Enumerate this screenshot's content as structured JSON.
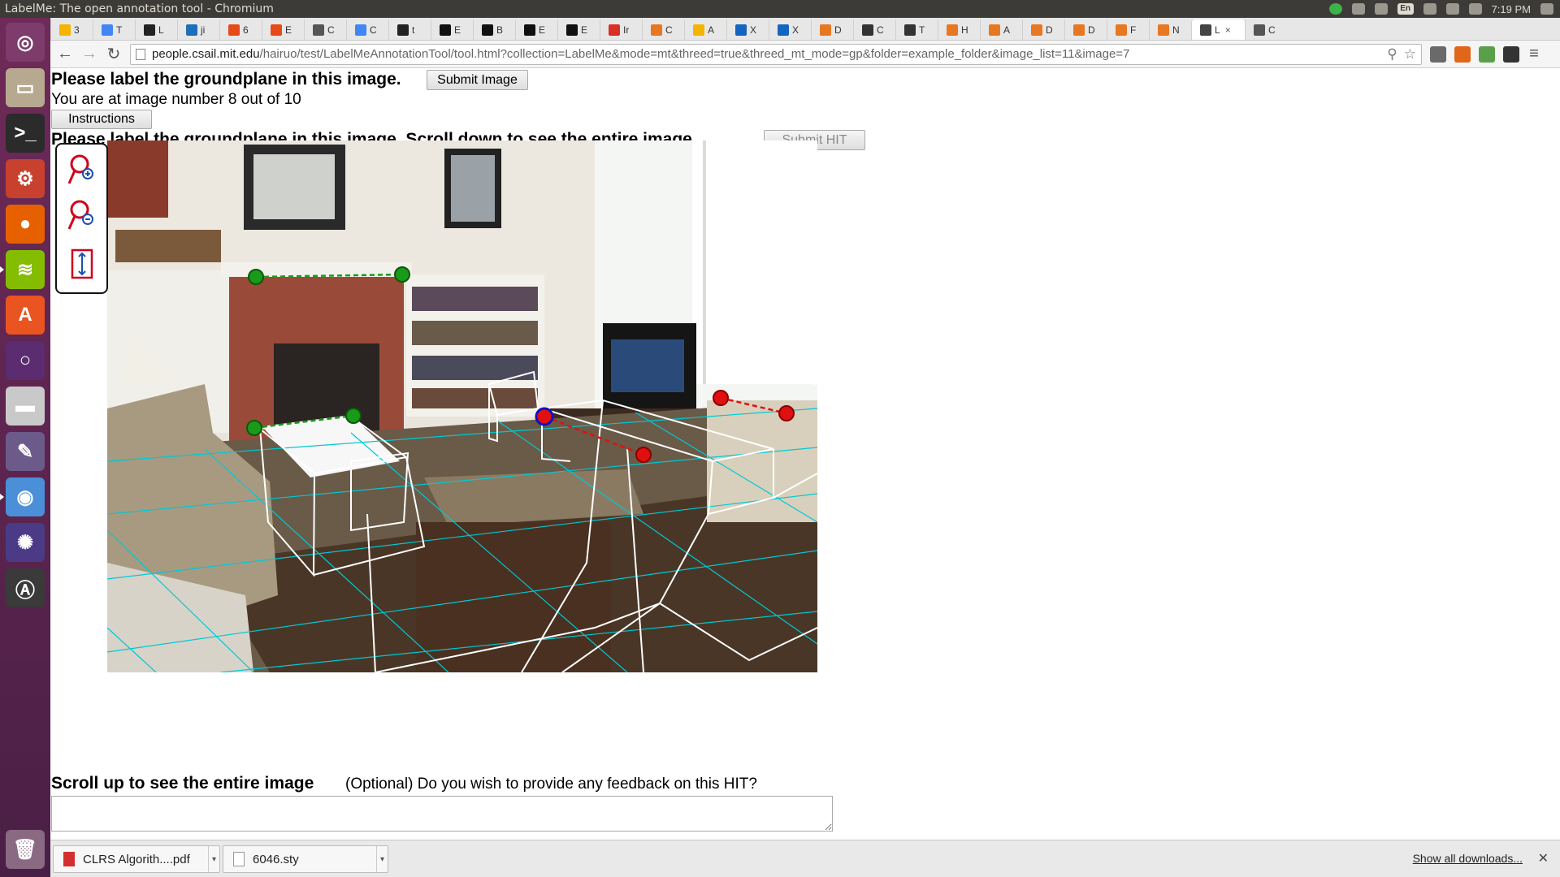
{
  "window": {
    "title": "LabelMe: The open annotation tool - Chromium"
  },
  "tray": {
    "lang": "En",
    "time": "7:19 PM"
  },
  "tabs": [
    {
      "label": "3",
      "color": "#f4b400"
    },
    {
      "label": "T",
      "color": "#4285f4"
    },
    {
      "label": "L",
      "color": "#222222"
    },
    {
      "label": "ji",
      "color": "#1e6fb8"
    },
    {
      "label": "6",
      "color": "#e64a19"
    },
    {
      "label": "E",
      "color": "#e64a19"
    },
    {
      "label": "C",
      "color": "#555555"
    },
    {
      "label": "C",
      "color": "#4285f4"
    },
    {
      "label": "t",
      "color": "#222222"
    },
    {
      "label": "E",
      "color": "#111111"
    },
    {
      "label": "B",
      "color": "#111111"
    },
    {
      "label": "E",
      "color": "#111111"
    },
    {
      "label": "E",
      "color": "#111111"
    },
    {
      "label": "Ir",
      "color": "#d93025"
    },
    {
      "label": "C",
      "color": "#e87722"
    },
    {
      "label": "A",
      "color": "#f4b400"
    },
    {
      "label": "X",
      "color": "#1565c0"
    },
    {
      "label": "X",
      "color": "#1565c0"
    },
    {
      "label": "D",
      "color": "#e87722"
    },
    {
      "label": "C",
      "color": "#333333"
    },
    {
      "label": "T",
      "color": "#333333"
    },
    {
      "label": "H",
      "color": "#e87722"
    },
    {
      "label": "A",
      "color": "#e87722"
    },
    {
      "label": "D",
      "color": "#e87722"
    },
    {
      "label": "D",
      "color": "#e87722"
    },
    {
      "label": "F",
      "color": "#e87722"
    },
    {
      "label": "N",
      "color": "#e87722"
    },
    {
      "label": "L",
      "color": "#444444",
      "active": true
    },
    {
      "label": "C",
      "color": "#555555"
    }
  ],
  "omnibox": {
    "host": "people.csail.mit.edu",
    "path": "/hairuo/test/LabelMeAnnotationTool/tool.html?collection=LabelMe&mode=mt&threed=true&threed_mt_mode=gp&folder=example_folder&image_list=11&image=7"
  },
  "page": {
    "heading": "Please label the groundplane in this image.",
    "submit_image": "Submit Image",
    "progress": "You are at image number 8 out of 10",
    "instructions": "Instructions",
    "heading2": "Please label the groundplane in this image. Scroll down to see the entire image.",
    "submit_hit": "Submit HIT",
    "scroll_up": "Scroll up to see the entire image",
    "feedback_q": "(Optional) Do you wish to provide any feedback on this HIT?",
    "feedback_value": ""
  },
  "toolbox": {
    "tools": [
      "zoom-in-icon",
      "zoom-out-icon",
      "fit-image-icon"
    ]
  },
  "downloads": {
    "items": [
      {
        "name": "CLRS Algorith....pdf",
        "type": "pdf"
      },
      {
        "name": "6046.sty",
        "type": "file"
      }
    ],
    "show_all": "Show all downloads..."
  }
}
